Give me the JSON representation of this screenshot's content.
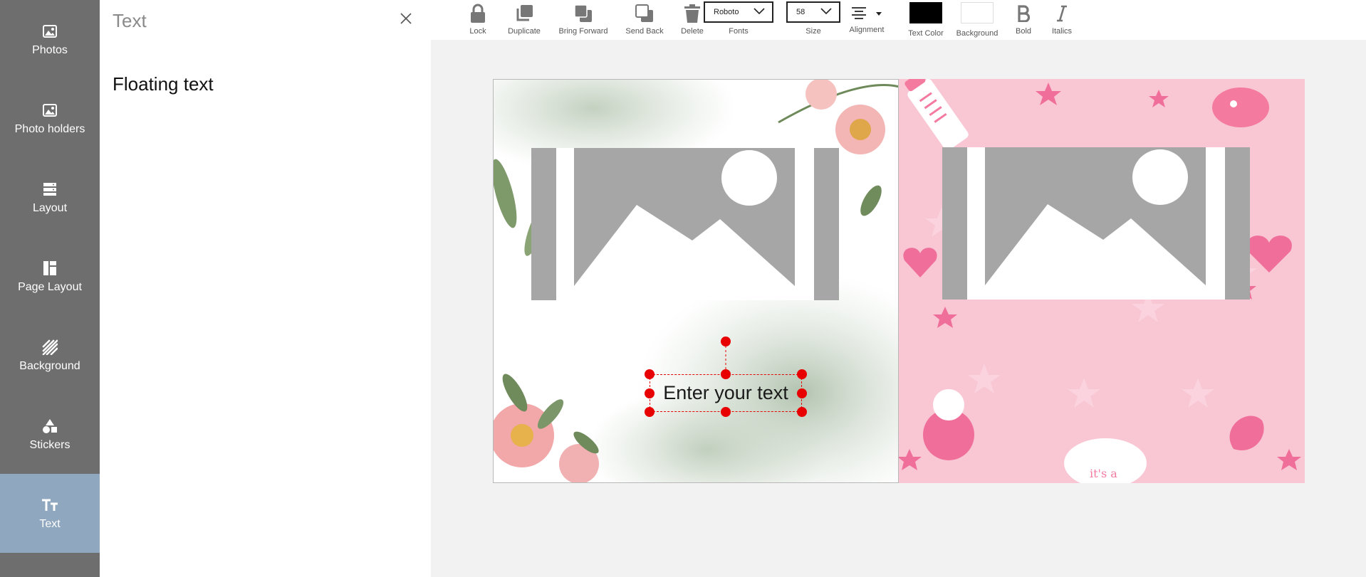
{
  "sidebar": {
    "items": [
      {
        "label": "Photos",
        "icon": "photo-icon"
      },
      {
        "label": "Photo holders",
        "icon": "photo-holder-icon"
      },
      {
        "label": "Layout",
        "icon": "layout-icon"
      },
      {
        "label": "Page Layout",
        "icon": "page-layout-icon"
      },
      {
        "label": "Background",
        "icon": "background-icon"
      },
      {
        "label": "Stickers",
        "icon": "stickers-icon"
      },
      {
        "label": "Text",
        "icon": "text-icon",
        "active": true
      }
    ]
  },
  "panel": {
    "title": "Text",
    "items": [
      "Floating text"
    ]
  },
  "toolbar": {
    "lock": "Lock",
    "duplicate": "Duplicate",
    "bring_forward": "Bring Forward",
    "send_back": "Send Back",
    "delete": "Delete",
    "fonts_label": "Fonts",
    "font_value": "Roboto",
    "size_label": "Size",
    "size_value": "58",
    "alignment_label": "Alignment",
    "text_color_label": "Text Color",
    "background_label": "Background",
    "bold_label": "Bold",
    "italics_label": "Italics",
    "text_color": "#000000",
    "background_color": "#ffffff"
  },
  "canvas": {
    "text_box_value": "Enter your text",
    "sticker_text": "it's a"
  },
  "colors": {
    "sidebar": "#6e6e6e",
    "sidebar_active": "#8fa7bf",
    "handle": "#e80000",
    "placeholder_grey": "#a6a6a6",
    "pink": "#f9c6d4"
  }
}
